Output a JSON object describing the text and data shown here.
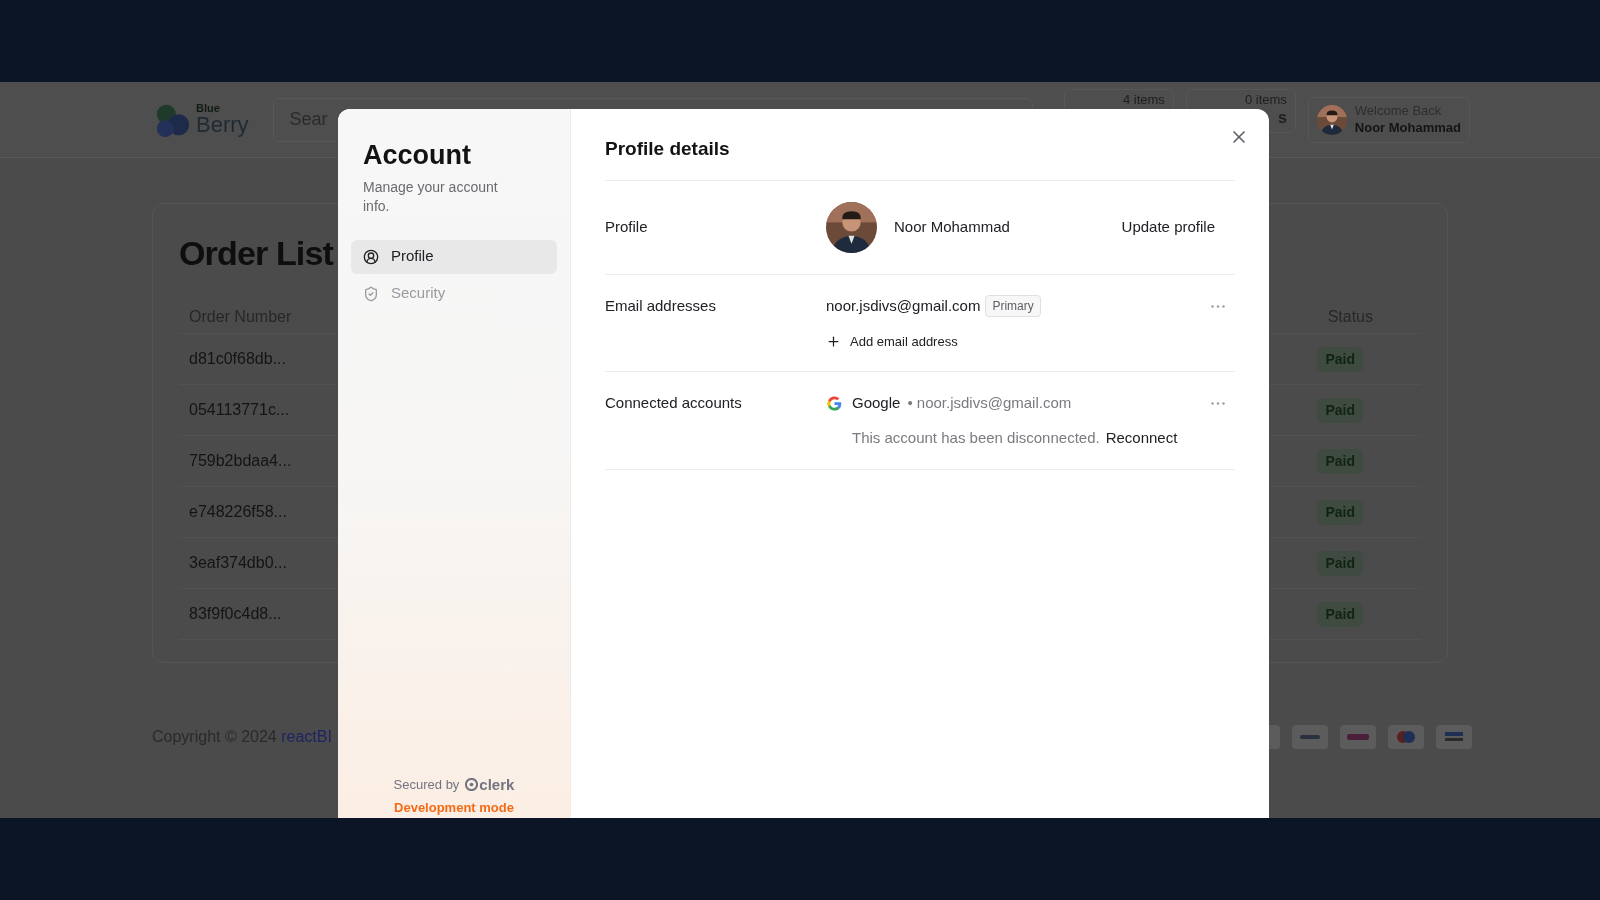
{
  "page": {
    "header": {
      "logo_small": "Blue",
      "logo": "Berry",
      "search": {
        "placeholder": "Sear"
      },
      "carts": [
        {
          "count": "4 items"
        },
        {
          "count": "0 items",
          "label": "s"
        }
      ],
      "user": {
        "greeting": "Welcome Back",
        "name": "Noor Mohammad"
      }
    },
    "order_list": {
      "title": "Order List",
      "columns": [
        "Order Number",
        "Status"
      ],
      "rows": [
        {
          "order_number": "d81c0f68db...",
          "status": "Paid"
        },
        {
          "order_number": "054113771c...",
          "status": "Paid"
        },
        {
          "order_number": "759b2bdaa4...",
          "status": "Paid"
        },
        {
          "order_number": "e748226f58...",
          "status": "Paid"
        },
        {
          "order_number": "3eaf374db0...",
          "status": "Paid"
        },
        {
          "order_number": "83f9f0c4d8...",
          "status": "Paid"
        }
      ]
    },
    "footer": {
      "copyright": "Copyright © 2024",
      "link": "reactBI"
    }
  },
  "modal": {
    "sidebar": {
      "title": "Account",
      "subtitle": "Manage your account info.",
      "nav": [
        {
          "kind": "profile",
          "label": "Profile",
          "selected": true
        },
        {
          "kind": "security",
          "label": "Security",
          "selected": false
        }
      ],
      "secured_by": "Secured by",
      "brand": "clerk",
      "dev_mode": "Development mode"
    },
    "title": "Profile details",
    "sections": [
      {
        "kind": "profile",
        "label": "Profile",
        "name": "Noor Mohammad",
        "action": "Update profile"
      },
      {
        "kind": "emails",
        "label": "Email addresses",
        "email": "noor.jsdivs@gmail.com",
        "badge": "Primary",
        "add": "Add email address"
      },
      {
        "kind": "connected",
        "label": "Connected accounts",
        "provider": "Google",
        "email": "• noor.jsdivs@gmail.com",
        "notice": "This account has been disconnected.",
        "action": "Reconnect"
      }
    ]
  }
}
